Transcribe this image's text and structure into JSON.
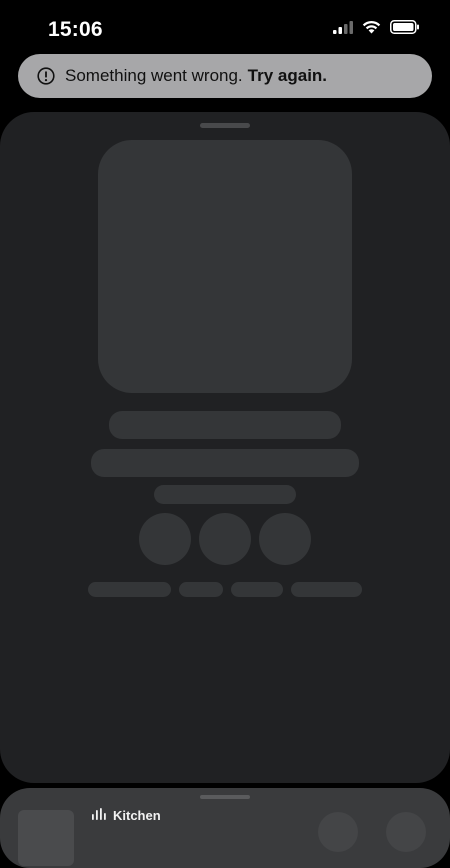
{
  "status_bar": {
    "time": "15:06",
    "icons": [
      "cellular-signal-icon",
      "wifi-icon",
      "battery-icon"
    ]
  },
  "toast": {
    "icon": "alert-circle-icon",
    "message": "Something went wrong.",
    "action_label": "Try again."
  },
  "now_playing": {
    "state": "loading-placeholder"
  },
  "mini_player": {
    "device_icon": "speaker-bars-icon",
    "device_name": "Kitchen"
  },
  "colors": {
    "background": "#000000",
    "sheet": "#202123",
    "skeleton": "#343638",
    "toast": "#a7a7a9",
    "mini_player": "#3a3b3d"
  }
}
